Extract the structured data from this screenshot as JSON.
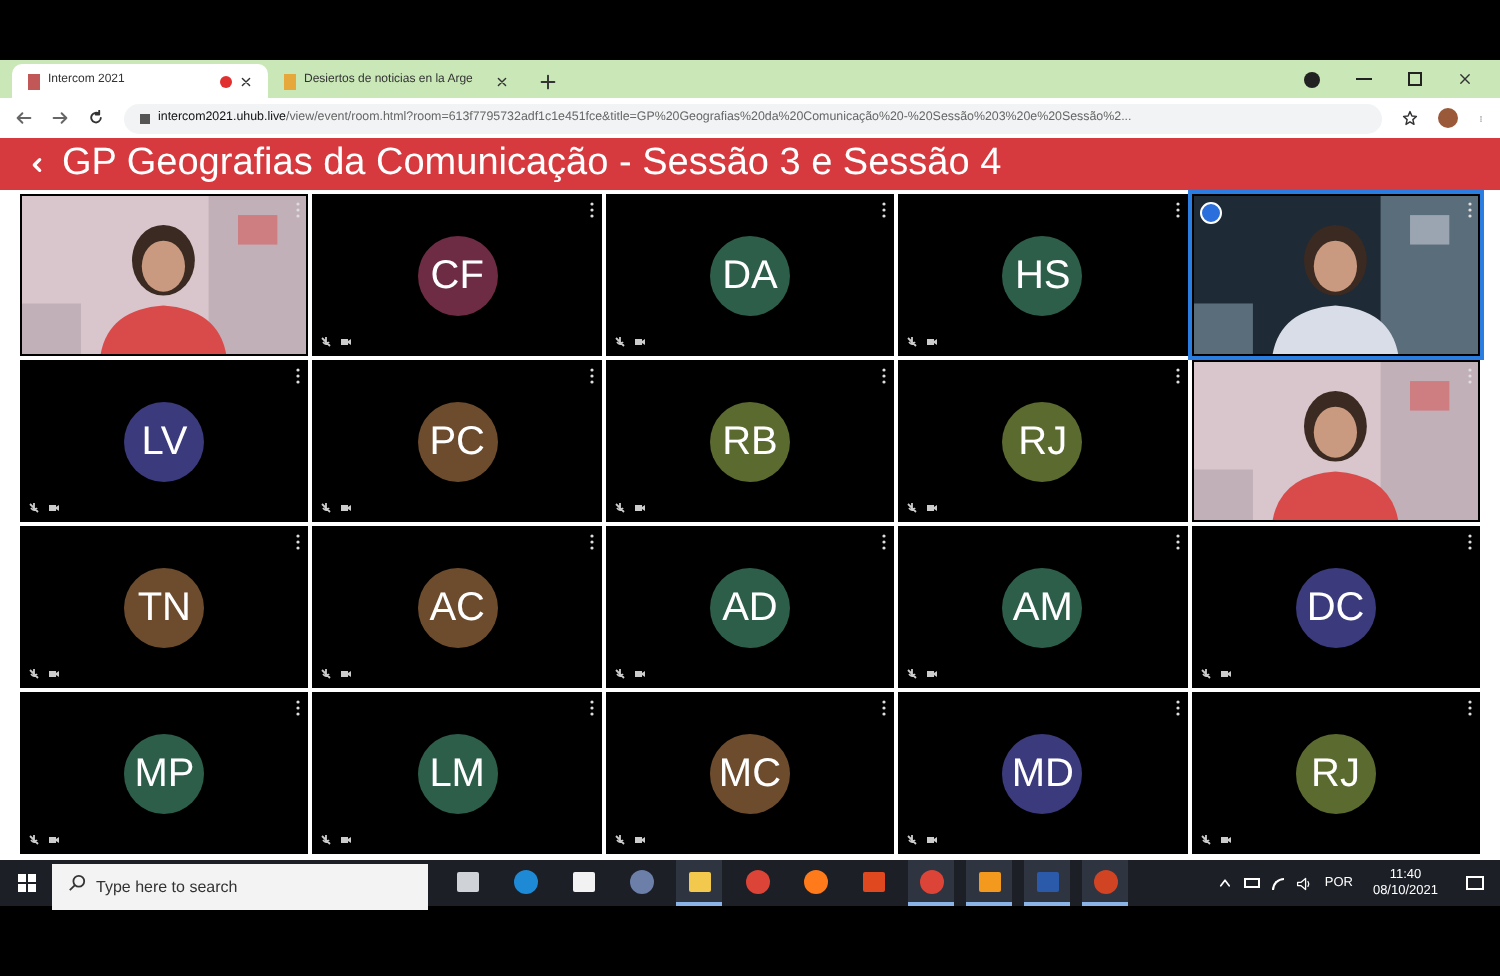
{
  "browser": {
    "tabs": [
      {
        "label": "Intercom 2021",
        "selected": true,
        "recording": true
      },
      {
        "label": "Desiertos de noticias en la Arge",
        "selected": false,
        "recording": false
      }
    ],
    "url_host": "intercom2021.uhub.live",
    "url_path": "/view/event/room.html?room=613f7795732adf1c1e451fce&title=GP%20Geografias%20da%20Comunicação%20-%20Sessão%203%20e%20Sessão%2..."
  },
  "header": {
    "title": "GP Geografias da Comunicação - Sessão 3 e Sessão 4"
  },
  "tiles": [
    {
      "kind": "picture",
      "speaking": false
    },
    {
      "kind": "avatar",
      "initials": "CF",
      "color": "#6e2b44",
      "speaking": false
    },
    {
      "kind": "avatar",
      "initials": "DA",
      "color": "#2d5e4a",
      "speaking": false
    },
    {
      "kind": "avatar",
      "initials": "HS",
      "color": "#2d5e4a",
      "speaking": false
    },
    {
      "kind": "picture",
      "speaking": true
    },
    {
      "kind": "avatar",
      "initials": "LV",
      "color": "#3a3a7c",
      "speaking": false
    },
    {
      "kind": "avatar",
      "initials": "PC",
      "color": "#6d4c2e",
      "speaking": false
    },
    {
      "kind": "avatar",
      "initials": "RB",
      "color": "#5b6a2f",
      "speaking": false
    },
    {
      "kind": "avatar",
      "initials": "RJ",
      "color": "#5b6a2f",
      "speaking": false
    },
    {
      "kind": "picture",
      "speaking": false
    },
    {
      "kind": "avatar",
      "initials": "TN",
      "color": "#6d4c2e",
      "speaking": false
    },
    {
      "kind": "avatar",
      "initials": "AC",
      "color": "#6d4c2e",
      "speaking": false
    },
    {
      "kind": "avatar",
      "initials": "AD",
      "color": "#2d5e4a",
      "speaking": false
    },
    {
      "kind": "avatar",
      "initials": "AM",
      "color": "#2d5e4a",
      "speaking": false
    },
    {
      "kind": "avatar",
      "initials": "DC",
      "color": "#3a3a7c",
      "speaking": false
    },
    {
      "kind": "avatar",
      "initials": "MP",
      "color": "#2d5e4a",
      "speaking": false
    },
    {
      "kind": "avatar",
      "initials": "LM",
      "color": "#2d5e4a",
      "speaking": false
    },
    {
      "kind": "avatar",
      "initials": "MC",
      "color": "#6d4c2e",
      "speaking": false
    },
    {
      "kind": "avatar",
      "initials": "MD",
      "color": "#3a3a7c",
      "speaking": false
    },
    {
      "kind": "avatar",
      "initials": "RJ",
      "color": "#5b6a2f",
      "speaking": false
    }
  ],
  "taskbar": {
    "search": {
      "placeholder": "Type here to search"
    },
    "apps": [
      {
        "kind": "taskview",
        "running": false
      },
      {
        "kind": "edge",
        "running": false
      },
      {
        "kind": "store",
        "running": false
      },
      {
        "kind": "orb",
        "running": false
      },
      {
        "kind": "folder",
        "running": true
      },
      {
        "kind": "chrome",
        "running": false
      },
      {
        "kind": "firefox",
        "running": false
      },
      {
        "kind": "office",
        "running": false
      },
      {
        "kind": "chrome",
        "running": true
      },
      {
        "kind": "orange",
        "running": true
      },
      {
        "kind": "word",
        "running": true
      },
      {
        "kind": "powerpoint",
        "running": true
      }
    ],
    "language": "POR",
    "time": "11:40",
    "date": "08/10/2021"
  }
}
